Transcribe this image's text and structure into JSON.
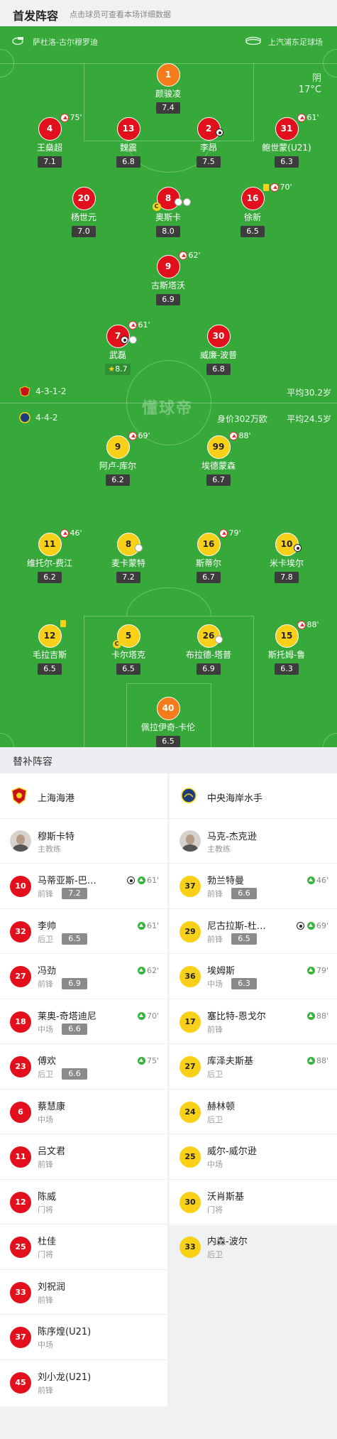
{
  "header": {
    "title": "首发阵容",
    "subtitle": "点击球员可查看本场详细数据"
  },
  "venue": {
    "left": "萨杜洛-古尔穆罗迪",
    "right": "上汽浦东足球场"
  },
  "weather": {
    "condition": "阴",
    "temperature": "17°C"
  },
  "watermark": "懂球帝",
  "home_team": {
    "formation": "4-3-1-2",
    "avg_age": "平均30.2岁"
  },
  "away_team": {
    "formation": "4-4-2",
    "value": "身价302万欧",
    "avg_age": "平均24.5岁"
  },
  "home_players": [
    {
      "no": "1",
      "name": "颜骏凌",
      "rating": "7.4"
    },
    {
      "no": "4",
      "name": "王燊超",
      "rating": "7.1",
      "sub_min": "75'"
    },
    {
      "no": "13",
      "name": "魏震",
      "rating": "6.8"
    },
    {
      "no": "2",
      "name": "李昂",
      "rating": "7.5"
    },
    {
      "no": "31",
      "name": "鲍世蒙(U21)",
      "rating": "6.3",
      "sub_min": "61'"
    },
    {
      "no": "20",
      "name": "杨世元",
      "rating": "7.0"
    },
    {
      "no": "8",
      "name": "奥斯卡",
      "rating": "8.0"
    },
    {
      "no": "16",
      "name": "徐新",
      "rating": "6.5",
      "sub_min": "70'"
    },
    {
      "no": "9",
      "name": "古斯塔沃",
      "rating": "6.9",
      "sub_min": "62'"
    },
    {
      "no": "7",
      "name": "武磊",
      "rating": "8.7",
      "sub_min": "61'"
    },
    {
      "no": "30",
      "name": "威廉-波普",
      "rating": "6.8"
    }
  ],
  "away_players": [
    {
      "no": "9",
      "name": "阿卢-库尔",
      "rating": "6.2",
      "sub_min": "69'"
    },
    {
      "no": "99",
      "name": "埃德蒙森",
      "rating": "6.7",
      "sub_min": "88'"
    },
    {
      "no": "11",
      "name": "维托尔-费江",
      "rating": "6.2",
      "sub_min": "46'"
    },
    {
      "no": "8",
      "name": "麦卡蒙特",
      "rating": "7.2"
    },
    {
      "no": "16",
      "name": "斯蒂尔",
      "rating": "6.7",
      "sub_min": "79'"
    },
    {
      "no": "10",
      "name": "米卡埃尔",
      "rating": "7.8"
    },
    {
      "no": "12",
      "name": "毛拉吉斯",
      "rating": "6.5"
    },
    {
      "no": "5",
      "name": "卡尔塔克",
      "rating": "6.5"
    },
    {
      "no": "26",
      "name": "布拉德-塔普",
      "rating": "6.9"
    },
    {
      "no": "15",
      "name": "斯托姆-鲁",
      "rating": "6.3",
      "sub_min": "88'"
    },
    {
      "no": "40",
      "name": "佩拉伊奇-卡伦",
      "rating": "6.5"
    }
  ],
  "subs_section": {
    "title": "替补阵容"
  },
  "subs_left": {
    "team_name": "上海海港",
    "coach": {
      "name": "穆斯卡特",
      "role": "主教练"
    },
    "players": [
      {
        "no": "10",
        "name": "马蒂亚斯-巴…",
        "pos": "前锋",
        "rating": "7.2",
        "time": "61'"
      },
      {
        "no": "32",
        "name": "李帅",
        "pos": "后卫",
        "rating": "6.5",
        "time": "61'"
      },
      {
        "no": "27",
        "name": "冯劲",
        "pos": "前锋",
        "rating": "6.9",
        "time": "62'"
      },
      {
        "no": "18",
        "name": "莱奥-奇塔迪尼",
        "pos": "中场",
        "rating": "6.6",
        "time": "70'"
      },
      {
        "no": "23",
        "name": "傅欢",
        "pos": "后卫",
        "rating": "6.6",
        "time": "75'"
      },
      {
        "no": "6",
        "name": "蔡慧康",
        "pos": "中场"
      },
      {
        "no": "11",
        "name": "吕文君",
        "pos": "前锋"
      },
      {
        "no": "12",
        "name": "陈威",
        "pos": "门将"
      },
      {
        "no": "25",
        "name": "杜佳",
        "pos": "门将"
      },
      {
        "no": "33",
        "name": "刘祝润",
        "pos": "前锋"
      },
      {
        "no": "37",
        "name": "陈序煌(U21)",
        "pos": "中场"
      },
      {
        "no": "45",
        "name": "刘小龙(U21)",
        "pos": "前锋"
      }
    ]
  },
  "subs_right": {
    "team_name": "中央海岸水手",
    "coach": {
      "name": "马克-杰克逊",
      "role": "主教练"
    },
    "players": [
      {
        "no": "37",
        "name": "勃兰特曼",
        "pos": "前锋",
        "rating": "6.6",
        "time": "46'"
      },
      {
        "no": "29",
        "name": "尼古拉斯-杜…",
        "pos": "前锋",
        "rating": "6.5",
        "time": "69'"
      },
      {
        "no": "36",
        "name": "埃姆斯",
        "pos": "中场",
        "rating": "6.3",
        "time": "79'"
      },
      {
        "no": "17",
        "name": "塞比特-恩戈尔",
        "pos": "前锋",
        "time": "88'"
      },
      {
        "no": "27",
        "name": "库泽夫斯基",
        "pos": "后卫",
        "time": "88'"
      },
      {
        "no": "24",
        "name": "赫林顿",
        "pos": "后卫"
      },
      {
        "no": "25",
        "name": "威尔-威尔逊",
        "pos": "中场"
      },
      {
        "no": "30",
        "name": "沃肖斯基",
        "pos": "门将"
      },
      {
        "no": "33",
        "name": "内森-波尔",
        "pos": "后卫"
      }
    ]
  }
}
